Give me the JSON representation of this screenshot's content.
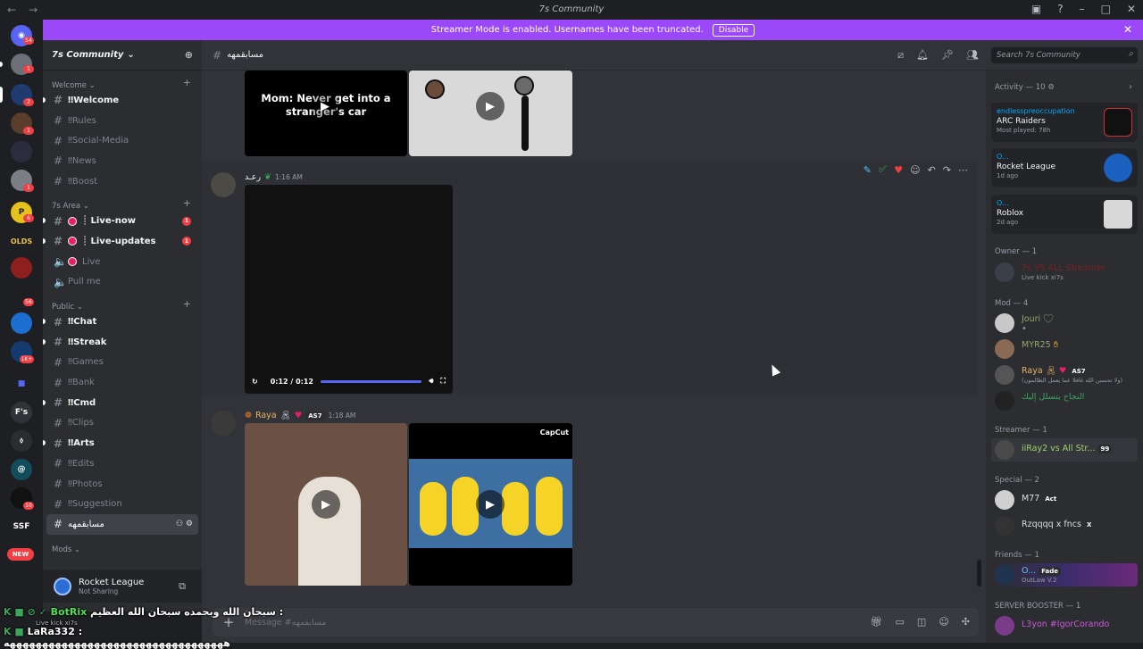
{
  "window": {
    "title": "7s Community",
    "nav_back": "←",
    "nav_forward": "→"
  },
  "banner": {
    "text": "Streamer Mode is enabled. Usernames have been truncated.",
    "button": "Disable",
    "close": "✕"
  },
  "guilds": {
    "badges": [
      "54",
      "1",
      "2",
      "1",
      "1",
      "6",
      "56",
      "1K+",
      "10"
    ],
    "labels": [
      "OLDS",
      "F's",
      "SSF",
      "NEW"
    ]
  },
  "server": {
    "name": "7s Community"
  },
  "categories": {
    "welcome": "Welcome",
    "area": "7s Area",
    "public": "Public",
    "mods": "Mods"
  },
  "channels": {
    "welcome": [
      "Welcome",
      "Rules",
      "Social-Media",
      "News",
      "Boost"
    ],
    "area": [
      {
        "name": "┊ Live-now",
        "badge": "1"
      },
      {
        "name": "┊ Live-updates",
        "badge": "1"
      },
      {
        "name": "Live",
        "badge": ""
      },
      {
        "name": "Pull me",
        "badge": ""
      }
    ],
    "public": [
      "Chat",
      "Streak",
      "Games",
      "Bank",
      "Cmd",
      "Clips",
      "Arts",
      "Edits",
      "Photos",
      "Suggestion",
      "مسابقمهه"
    ]
  },
  "activity_panel": {
    "game": "Rocket League",
    "status": "Not Sharing"
  },
  "channel_header": {
    "name": "مسابقمهه"
  },
  "search": {
    "placeholder": "Search 7s Community"
  },
  "messages": {
    "top_caption": "Mom: Never get into a stranger's car",
    "msg1": {
      "author": "رعـد",
      "time": "1:16 AM",
      "video_time": "0:12 / 0:12"
    },
    "msg2": {
      "author": "Raya",
      "tag": "AS7",
      "time": "1:18 AM",
      "capcut": "CapCut"
    }
  },
  "composer": {
    "placeholder": "Message #مسابقمهه"
  },
  "members": {
    "activity_header": "Activity — 10",
    "activities": [
      {
        "user": "endlesspreoccupation",
        "game": "ARC Raiders",
        "detail": "Most played: 78h"
      },
      {
        "user": "O...",
        "game": "Rocket League",
        "detail": "1d ago"
      },
      {
        "user": "O...",
        "game": "Roblox",
        "detail": "2d ago"
      }
    ],
    "owner_header": "Owner — 1",
    "owner": {
      "name": "7s VS ALL Streamer",
      "sub": "Live kick xi7s"
    },
    "mod_header": "Mod — 4",
    "mods": [
      {
        "name": "Jouri",
        "sub": "✦"
      },
      {
        "name": "MYR25",
        "sub": ""
      },
      {
        "name": "Raya",
        "tag": "AS7",
        "sub": "(ولا تحسبن الله غافلا عما يعمل الظالمون)"
      },
      {
        "name": "النجاح يتسلل إليك",
        "sub": ""
      }
    ],
    "streamer_header": "Streamer — 1",
    "streamer": {
      "name": "iiRay2 vs All Str...",
      "tag": "99"
    },
    "special_header": "Special — 2",
    "special": [
      {
        "name": "M77",
        "tag": "Act"
      },
      {
        "name": "Rzqqqq x fncs",
        "tag": "X"
      }
    ],
    "friends_header": "Friends — 1",
    "friend": {
      "name": "O...",
      "tag": "Fade",
      "sub": "OutLaw V.2"
    },
    "booster_header": "SERVER BOOSTER — 1",
    "booster": {
      "name": "L3yon #IgorCorando"
    }
  },
  "overlay": {
    "line1_name": "BotRix",
    "line1_text": "سبحان الله وبحمده سبحان الله العظيم :",
    "line2_name": "LaRa332",
    "line2_text": ": ههههههههههههههههههههههههههههههههههه",
    "sub_text": "Live kick xi7s"
  }
}
